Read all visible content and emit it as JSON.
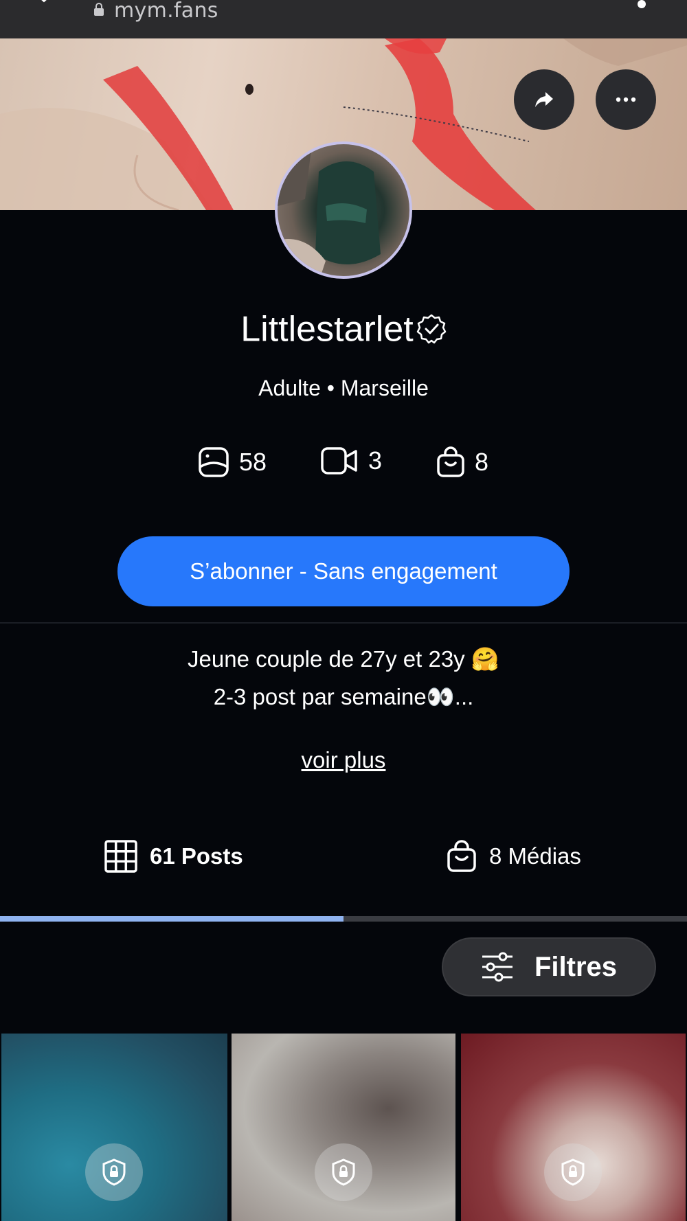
{
  "browser": {
    "url": "mym.fans"
  },
  "profile": {
    "username": "Littlestarlet",
    "meta": "Adulte • Marseille",
    "stats": {
      "photos": "58",
      "videos": "3",
      "products": "8"
    },
    "subscribe_label": "S’abonner - Sans engagement",
    "bio_line1": "Jeune couple de 27y et 23y 🤗",
    "bio_line2": "2-3 post par semaine👀...",
    "see_more_label": "voir plus"
  },
  "tabs": [
    {
      "label": "61 Posts",
      "icon": "grid-icon",
      "active": true
    },
    {
      "label": "8 Médias",
      "icon": "bag-icon",
      "active": false
    }
  ],
  "filters_label": "Filtres",
  "grid": {
    "tiles": [
      {
        "locked": true
      },
      {
        "locked": true
      },
      {
        "locked": true
      }
    ]
  },
  "colors": {
    "accent": "#2778fb",
    "background": "#04060b",
    "tab_indicator": "#8fb3f0"
  }
}
